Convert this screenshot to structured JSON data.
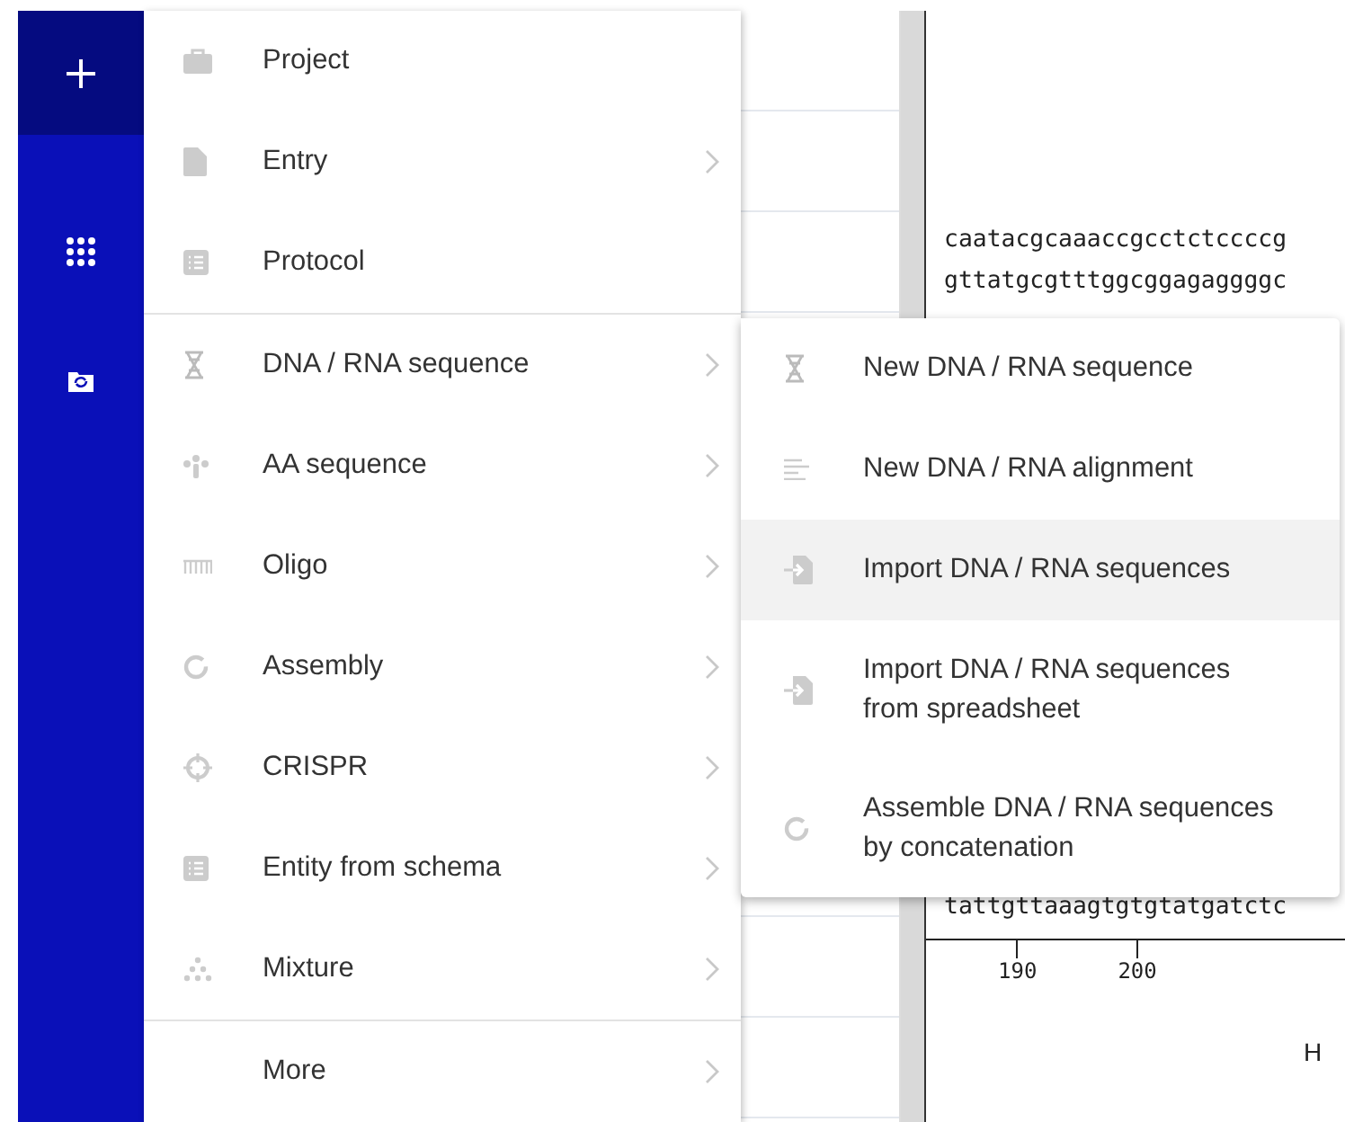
{
  "sidebar": {
    "buttons": [
      {
        "kind": "plus",
        "selected": true
      },
      {
        "kind": "grid",
        "selected": false
      },
      {
        "kind": "folder",
        "selected": false
      }
    ]
  },
  "menu": {
    "groups": [
      {
        "items": [
          {
            "kind": "briefcase",
            "label": "Project",
            "has_submenu": false,
            "selected": false
          },
          {
            "kind": "file",
            "label": "Entry",
            "has_submenu": true,
            "selected": false
          },
          {
            "kind": "list",
            "label": "Protocol",
            "has_submenu": false,
            "selected": false
          }
        ]
      },
      {
        "items": [
          {
            "kind": "dna",
            "label": "DNA / RNA sequence",
            "has_submenu": true,
            "selected": false
          },
          {
            "kind": "aa",
            "label": "AA sequence",
            "has_submenu": true,
            "selected": false
          },
          {
            "kind": "oligo",
            "label": "Oligo",
            "has_submenu": true,
            "selected": false
          },
          {
            "kind": "ring",
            "label": "Assembly",
            "has_submenu": true,
            "selected": false
          },
          {
            "kind": "target",
            "label": "CRISPR",
            "has_submenu": true,
            "selected": false
          },
          {
            "kind": "list",
            "label": "Entity from schema",
            "has_submenu": true,
            "selected": false
          },
          {
            "kind": "dots",
            "label": "Mixture",
            "has_submenu": true,
            "selected": false
          }
        ]
      },
      {
        "items": [
          {
            "kind": "none",
            "label": "More",
            "has_submenu": true,
            "selected": false
          }
        ]
      }
    ]
  },
  "submenu": {
    "items": [
      {
        "kind": "dna",
        "label": "New DNA / RNA sequence",
        "selected": false
      },
      {
        "kind": "lines",
        "label": "New DNA / RNA alignment",
        "selected": false
      },
      {
        "kind": "import",
        "label": "Import DNA / RNA sequences",
        "selected": true
      },
      {
        "kind": "import",
        "label": "Import DNA / RNA sequences from spreadsheet",
        "selected": false
      },
      {
        "kind": "ring",
        "label": "Assemble DNA / RNA sequences by concatenation",
        "selected": false
      }
    ]
  },
  "sequence": {
    "top_strand": "caatacgcaaaccgcctctccccg",
    "bottom_strand": "gttatgcgtttggcggagaggggc",
    "lower_strand": "tattgttaaagtgtgtatgatctc",
    "ruler_ticks": [
      "190",
      "200"
    ],
    "label": "H"
  }
}
